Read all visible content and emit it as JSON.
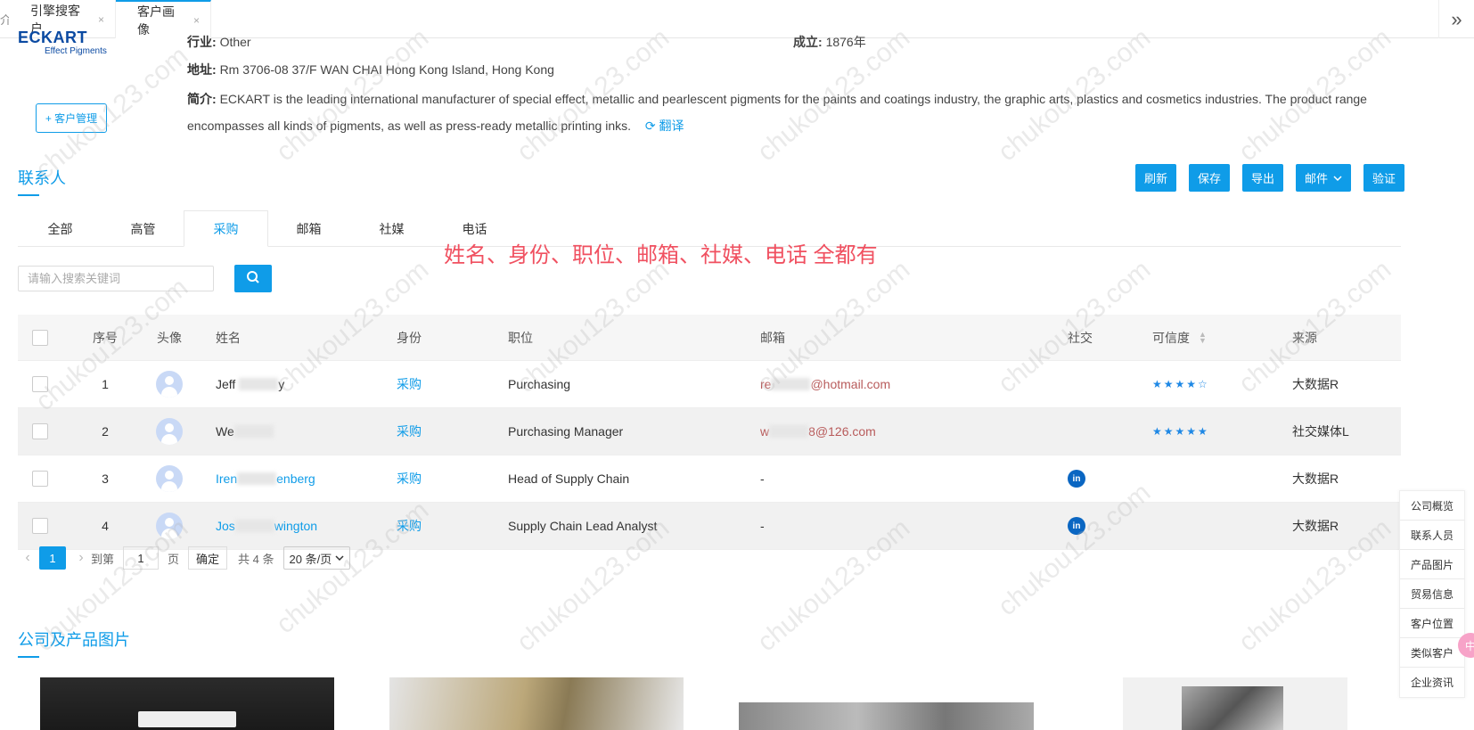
{
  "tabs": [
    {
      "label": "引擎搜客户",
      "close": "×"
    },
    {
      "label": "客户画像",
      "close": "×"
    }
  ],
  "home_glyph": "介",
  "more_glyph": "»",
  "company": {
    "logo_brand": "ECKART",
    "logo_sub": "Effect Pigments",
    "customer_button": "+ 客户管理",
    "industry_label": "行业:",
    "industry_value": "Other",
    "founded_label": "成立:",
    "founded_value": "1876年",
    "address_label": "地址:",
    "address_value": "Rm 3706-08 37/F WAN CHAI Hong Kong Island, Hong Kong",
    "intro_label": "简介:",
    "intro_value": "ECKART is the leading international manufacturer of special effect, metallic and pearlescent pigments for the paints and coatings industry, the graphic arts, plastics and cosmetics industries. The product range encompasses all kinds of pigments, as well as press-ready metallic printing inks.",
    "translate": "翻译"
  },
  "contacts": {
    "title": "联系人",
    "actions": [
      "刷新",
      "保存",
      "导出",
      "邮件",
      "验证"
    ],
    "tabs": [
      "全部",
      "高管",
      "采购",
      "邮箱",
      "社媒",
      "电话"
    ],
    "active_tab": "采购",
    "note": "姓名、身份、职位、邮箱、社媒、电话 全都有",
    "search_placeholder": "请输入搜索关键词",
    "columns": [
      "序号",
      "头像",
      "姓名",
      "身份",
      "职位",
      "邮箱",
      "社交",
      "可信度",
      "来源"
    ],
    "rows": [
      {
        "no": "1",
        "name_a": "Jeff",
        "name_b": "y",
        "role": "采购",
        "position": "Purchasing",
        "email_a": "re",
        "email_b": "@hotmail.com",
        "social": "",
        "stars": "★★★★☆",
        "source": "大数据R"
      },
      {
        "no": "2",
        "name_a": "We",
        "name_b": "",
        "role": "采购",
        "position": "Purchasing Manager",
        "email_a": "w",
        "email_b": "8@126.com",
        "social": "",
        "stars": "★★★★★",
        "source": "社交媒体L"
      },
      {
        "no": "3",
        "name_a": "Iren",
        "name_b": "enberg",
        "role": "采购",
        "position": "Head of Supply Chain",
        "email_a": "-",
        "email_b": "",
        "social": "in",
        "stars": "",
        "source": "大数据R"
      },
      {
        "no": "4",
        "name_a": "Jos",
        "name_b": "wington",
        "role": "采购",
        "position": "Supply Chain Lead Analyst",
        "email_a": "-",
        "email_b": "",
        "social": "in",
        "stars": "",
        "source": "大数据R"
      }
    ]
  },
  "pager": {
    "current": "1",
    "goto_label": "到第",
    "goto_value": "1",
    "page_unit": "页",
    "confirm": "确定",
    "total": "共 4 条",
    "page_size": "20 条/页"
  },
  "products": {
    "title": "公司及产品图片"
  },
  "right_nav": [
    "公司概览",
    "联系人员",
    "产品图片",
    "贸易信息",
    "客户位置",
    "类似客户",
    "企业资讯"
  ],
  "bubble": "中",
  "watermark": "chukou123.com",
  "colors": {
    "accent": "#0f9ce8",
    "note": "#f05060",
    "email": "#b85b5b",
    "linkedin": "#0a66c2"
  }
}
